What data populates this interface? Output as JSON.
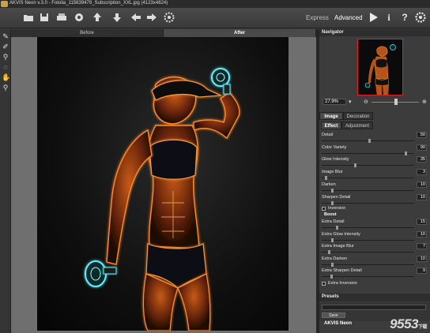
{
  "window": {
    "title": "AKVIS Neon v.3.0 - Fotolia_115639479_Subscription_XXL.jpg (4123x4824)"
  },
  "toolbar": {
    "mode_express": "Express",
    "mode_advanced": "Advanced",
    "icons": [
      "open-icon",
      "save-icon",
      "print-icon",
      "share-icon",
      "upload-icon",
      "download-icon",
      "undo-icon",
      "redo-icon",
      "settings-icon",
      "run-icon",
      "info-icon",
      "help-icon",
      "preferences-icon"
    ]
  },
  "view_tabs": {
    "before": "Before",
    "after": "After"
  },
  "navigator": {
    "title": "Navigator",
    "zoom": "27.9%"
  },
  "panel_tabs": {
    "image": "Image",
    "decoration": "Decoration",
    "effect": "Effect",
    "adjustment": "Adjustment"
  },
  "params": [
    {
      "label": "Detail",
      "value": "50",
      "level": 0.5
    },
    {
      "label": "Color Variety",
      "value": "90",
      "level": 0.9
    },
    {
      "label": "Glow Intensity",
      "value": "35",
      "level": 0.35
    },
    {
      "label": "Image Blur",
      "value": "3",
      "level": 0.03
    },
    {
      "label": "Darken",
      "value": "10",
      "level": 0.1
    },
    {
      "label": "Sharpen Detail",
      "value": "10",
      "level": 0.1
    }
  ],
  "inversion": {
    "label": "Inversion",
    "checked": false
  },
  "boost": {
    "title": "Boost",
    "params": [
      {
        "label": "Extra Detail",
        "value": "15",
        "level": 0.15
      },
      {
        "label": "Extra Glow Intensity",
        "value": "10",
        "level": 0.1
      },
      {
        "label": "Extra Image Blur",
        "value": "7",
        "level": 0.07
      },
      {
        "label": "Extra Darken",
        "value": "10",
        "level": 0.1
      },
      {
        "label": "Extra Sharpen Detail",
        "value": "9",
        "level": 0.09
      }
    ],
    "extra_inversion": {
      "label": "Extra Inversion",
      "checked": false
    }
  },
  "presets": {
    "title": "Presets",
    "save_label": "Save",
    "brand": "AKVIS Neon"
  },
  "watermark": {
    "text": "9553",
    "sub": "下载"
  },
  "colors": {
    "accent": "#d22222",
    "glow_orange": "#ff7a1a",
    "glow_cyan": "#4fe0ff"
  }
}
